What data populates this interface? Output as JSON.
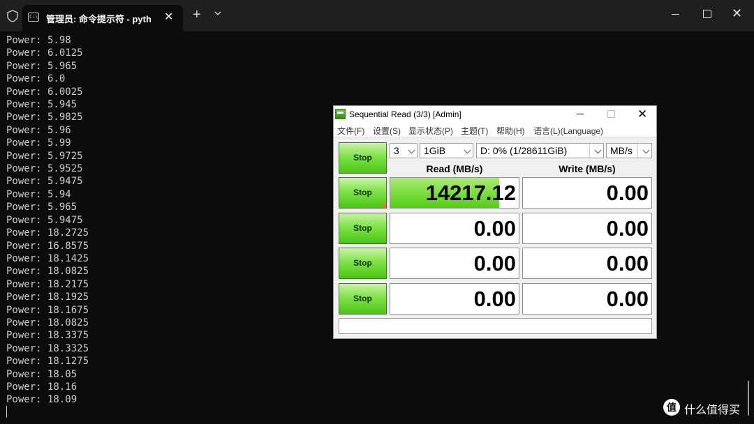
{
  "terminal": {
    "tab_title": "管理员: 命令提示符 - python p",
    "lines": [
      "Power: 5.98",
      "Power: 6.0125",
      "Power: 5.965",
      "Power: 6.0",
      "Power: 6.0025",
      "Power: 5.945",
      "Power: 5.9825",
      "Power: 5.96",
      "Power: 5.99",
      "Power: 5.9725",
      "Power: 5.9525",
      "Power: 5.9475",
      "Power: 5.94",
      "Power: 5.965",
      "Power: 5.9475",
      "Power: 18.2725",
      "Power: 16.8575",
      "Power: 18.1425",
      "Power: 18.0825",
      "Power: 18.2175",
      "Power: 18.1925",
      "Power: 18.1675",
      "Power: 18.0825",
      "Power: 18.3375",
      "Power: 18.3325",
      "Power: 18.1275",
      "Power: 18.05",
      "Power: 18.16",
      "Power: 18.09"
    ]
  },
  "icons": {
    "shield": "shield-icon",
    "tab": "terminal-icon",
    "new_tab": "plus-icon",
    "dropdown": "chevron-down-icon"
  },
  "cdm": {
    "title": "Sequential Read (3/3) [Admin]",
    "menu": [
      "文件(F)",
      "设置(S)",
      "显示状态(P)",
      "主题(T)",
      "帮助(H)",
      "语言(L)(Language)"
    ],
    "stop_label": "Stop",
    "count": "3",
    "size": "1GiB",
    "drive": "D: 0% (1/28611GiB)",
    "unit": "MB/s",
    "read_header": "Read (MB/s)",
    "write_header": "Write (MB/s)",
    "results": [
      {
        "read": "14217.12",
        "write": "0.00",
        "read_bar_fraction": 0.85
      },
      {
        "read": "0.00",
        "write": "0.00",
        "read_bar_fraction": 0
      },
      {
        "read": "0.00",
        "write": "0.00",
        "read_bar_fraction": 0
      },
      {
        "read": "0.00",
        "write": "0.00",
        "read_bar_fraction": 0
      }
    ],
    "status": ""
  },
  "watermark": {
    "logo": "值",
    "text": "什么值得买"
  },
  "colors": {
    "terminal_bg": "#0c0c0c",
    "terminal_text": "#cccccc",
    "accent_green": "#52cf12"
  }
}
